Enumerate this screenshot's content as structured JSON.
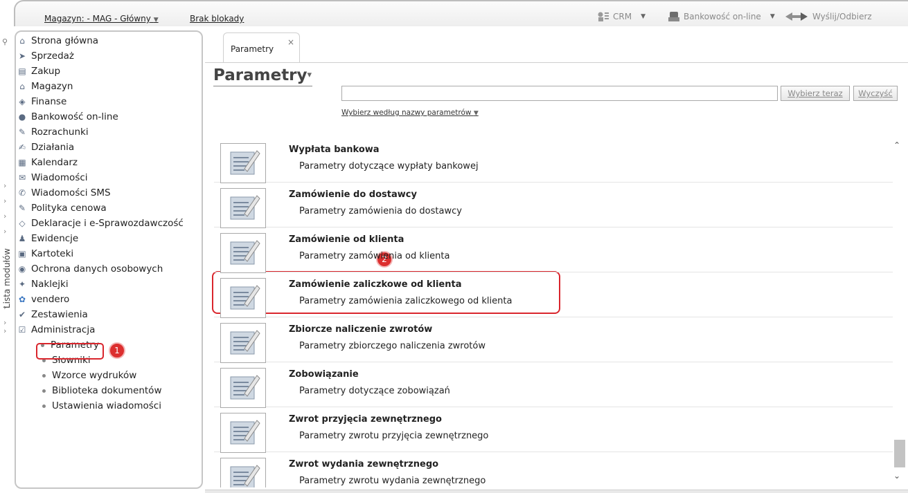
{
  "toolbar": {
    "warehouse_label": "Magazyn: - MAG - Główny",
    "lock_label": "Brak blokady",
    "crm_label": "CRM",
    "banking_label": "Bankowość on-line",
    "send_label": "Wyślij/Odbierz"
  },
  "sidebar": {
    "strip_label": "Lista modułów",
    "items": [
      {
        "label": "Strona główna",
        "icon": "home-icon"
      },
      {
        "label": "Sprzedaż",
        "icon": "sales-icon"
      },
      {
        "label": "Zakup",
        "icon": "purchase-icon"
      },
      {
        "label": "Magazyn",
        "icon": "warehouse-icon"
      },
      {
        "label": "Finanse",
        "icon": "finance-icon"
      },
      {
        "label": "Bankowość on-line",
        "icon": "bank-icon"
      },
      {
        "label": "Rozrachunki",
        "icon": "settlements-icon"
      },
      {
        "label": "Działania",
        "icon": "actions-icon"
      },
      {
        "label": "Kalendarz",
        "icon": "calendar-icon"
      },
      {
        "label": "Wiadomości",
        "icon": "messages-icon"
      },
      {
        "label": "Wiadomości SMS",
        "icon": "sms-icon"
      },
      {
        "label": "Polityka cenowa",
        "icon": "pricing-icon"
      },
      {
        "label": "Deklaracje i e-Sprawozdawczość",
        "icon": "declarations-icon"
      },
      {
        "label": "Ewidencje",
        "icon": "records-icon"
      },
      {
        "label": "Kartoteki",
        "icon": "files-icon"
      },
      {
        "label": "Ochrona danych osobowych",
        "icon": "privacy-icon"
      },
      {
        "label": "Naklejki",
        "icon": "stickers-icon"
      },
      {
        "label": "vendero",
        "icon": "vendero-icon"
      },
      {
        "label": "Zestawienia",
        "icon": "reports-icon"
      },
      {
        "label": "Administracja",
        "icon": "admin-icon"
      }
    ],
    "sub_items": [
      {
        "label": "Parametry"
      },
      {
        "label": "Słowniki"
      },
      {
        "label": "Wzorce wydruków"
      },
      {
        "label": "Biblioteka dokumentów"
      },
      {
        "label": "Ustawienia wiadomości"
      }
    ]
  },
  "annotations": {
    "badge1": "1",
    "badge2": "2"
  },
  "tab": {
    "label": "Parametry",
    "close": "×"
  },
  "main": {
    "title": "Parametry",
    "search_value": "",
    "choose_button": "Wybierz teraz",
    "clear_button": "Wyczyść",
    "filter_label": "Wybierz według nazwy parametrów"
  },
  "rows": [
    {
      "title": "Wypłata bankowa",
      "desc": "Parametry dotyczące wypłaty bankowej"
    },
    {
      "title": "Zamówienie do dostawcy",
      "desc": "Parametry zamówienia do dostawcy"
    },
    {
      "title": "Zamówienie od klienta",
      "desc": "Parametry zamówienia od klienta"
    },
    {
      "title": "Zamówienie zaliczkowe od klienta",
      "desc": "Parametry zamówienia zaliczkowego od klienta"
    },
    {
      "title": "Zbiorcze naliczenie zwrotów",
      "desc": "Parametry zbiorczego naliczenia zwrotów"
    },
    {
      "title": "Zobowiązanie",
      "desc": "Parametry dotyczące zobowiązań"
    },
    {
      "title": "Zwrot przyjęcia zewnętrznego",
      "desc": "Parametry zwrotu przyjęcia zewnętrznego"
    },
    {
      "title": "Zwrot wydania zewnętrznego",
      "desc": "Parametry zwrotu wydania zewnętrznego"
    }
  ]
}
